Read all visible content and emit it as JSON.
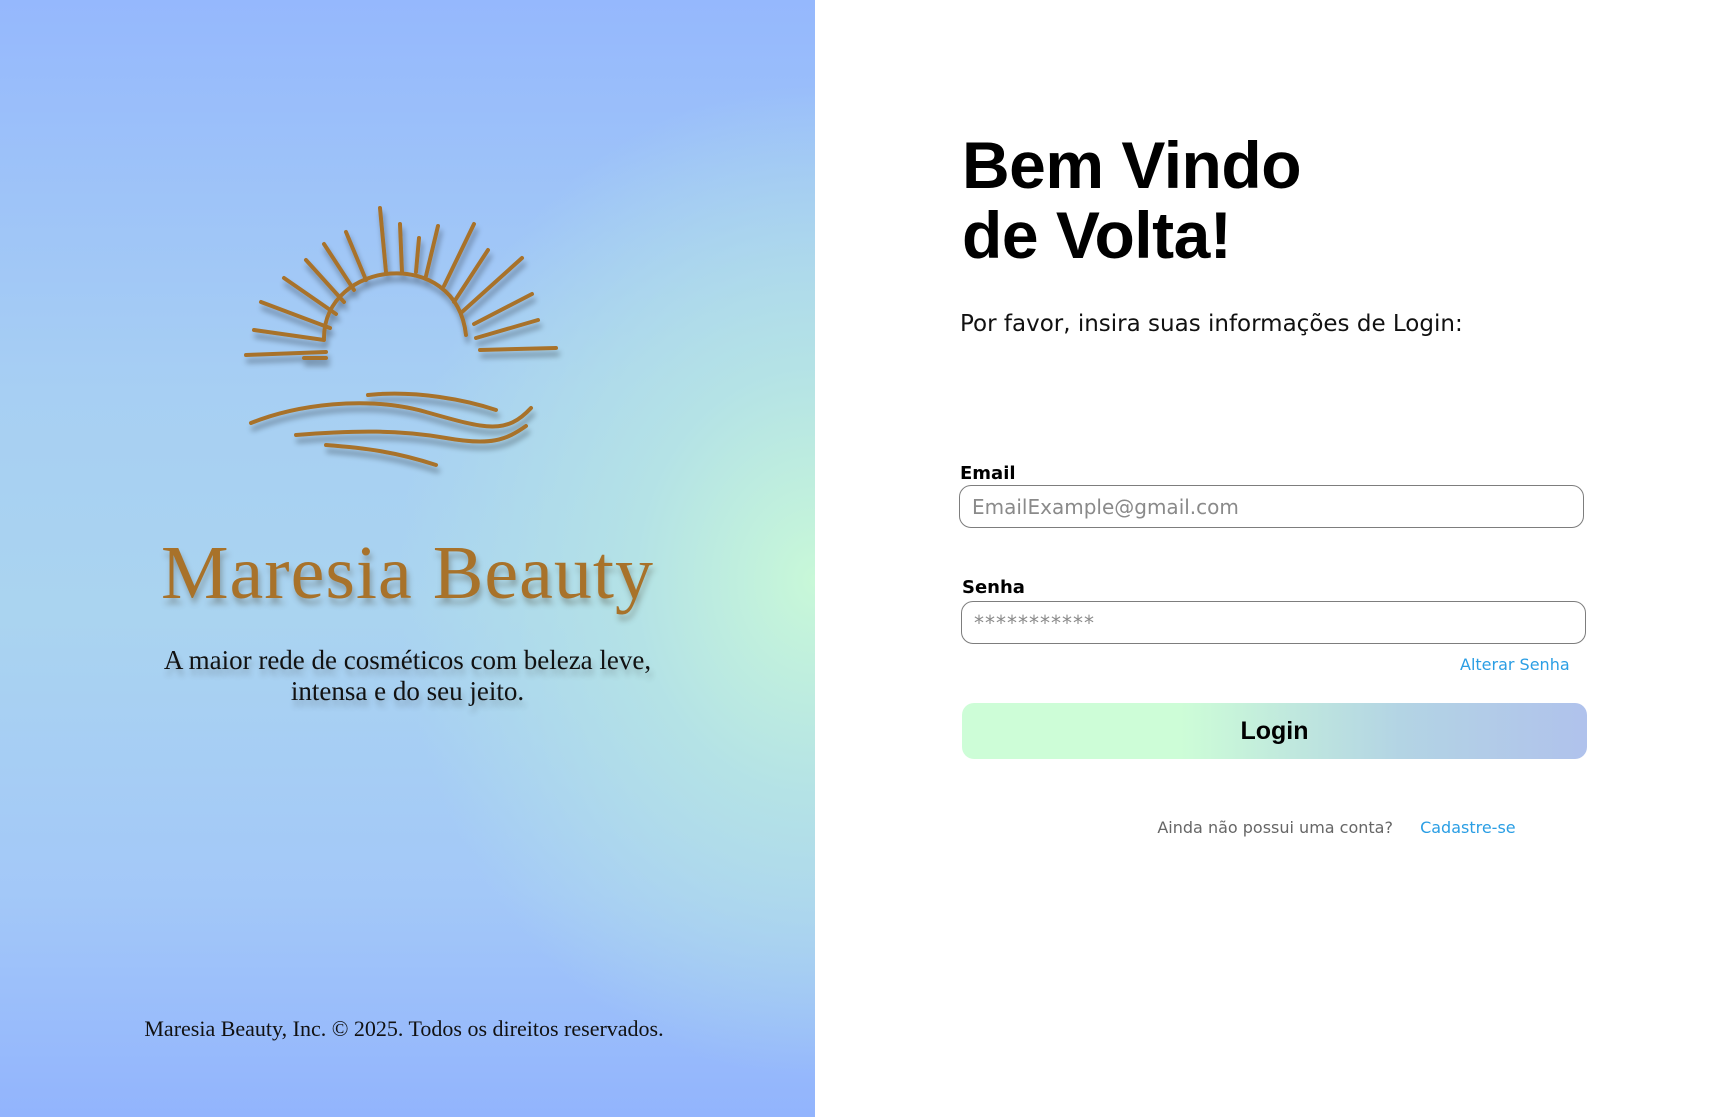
{
  "brand": {
    "name": "Maresia Beauty",
    "tagline_line1": "A maior rede de cosméticos com beleza leve,",
    "tagline_line2": "intensa e do seu jeito.",
    "copyright": "Maresia Beauty, Inc. © 2025. Todos os direitos reservados.",
    "logo_icon": "sun-over-waves-icon",
    "logo_color": "#a8722a"
  },
  "form": {
    "title_line1": "Bem Vindo",
    "title_line2": "de Volta!",
    "instructions": "Por favor, insira suas informações de Login:",
    "email": {
      "label": "Email",
      "placeholder": "EmailExample@gmail.com",
      "value": ""
    },
    "password": {
      "label": "Senha",
      "placeholder": "***********",
      "value": ""
    },
    "change_password_label": "Alterar Senha",
    "login_label": "Login",
    "signup_prompt": "Ainda não possui uma conta?",
    "signup_link": "Cadastre-se"
  },
  "colors": {
    "link": "#2a9ee4",
    "button_gradient_start": "#cdfdd7",
    "button_gradient_end": "#b0c2ec",
    "panel_blue": "#95b8fd",
    "panel_mint": "#c8f8d8"
  }
}
